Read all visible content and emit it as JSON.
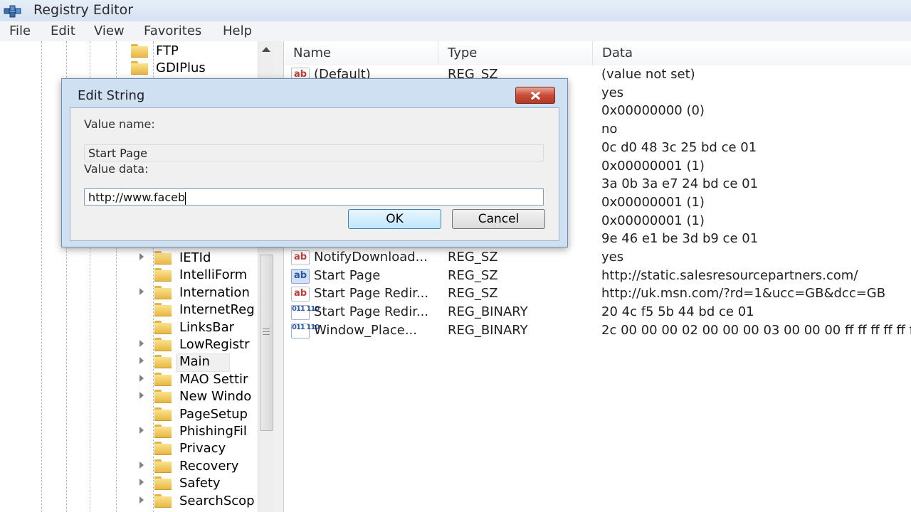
{
  "window": {
    "title": "Registry Editor"
  },
  "menu": [
    "File",
    "Edit",
    "View",
    "Favorites",
    "Help"
  ],
  "tree_top": [
    {
      "label": "FTP"
    },
    {
      "label": "GDIPlus"
    }
  ],
  "tree_items": [
    {
      "label": "IETId",
      "expandable": true
    },
    {
      "label": "IntelliForm",
      "expandable": false
    },
    {
      "label": "Internation",
      "expandable": true
    },
    {
      "label": "InternetReg",
      "expandable": false
    },
    {
      "label": "LinksBar",
      "expandable": false
    },
    {
      "label": "LowRegistr",
      "expandable": true
    },
    {
      "label": "Main",
      "expandable": true,
      "selected": true
    },
    {
      "label": "MAO Settir",
      "expandable": true
    },
    {
      "label": "New Windo",
      "expandable": true
    },
    {
      "label": "PageSetup",
      "expandable": false
    },
    {
      "label": "PhishingFil",
      "expandable": true
    },
    {
      "label": "Privacy",
      "expandable": false
    },
    {
      "label": "Recovery",
      "expandable": true
    },
    {
      "label": "Safety",
      "expandable": true
    },
    {
      "label": "SearchScop",
      "expandable": true
    }
  ],
  "columns": {
    "name": "Name",
    "type": "Type",
    "data": "Data"
  },
  "values": [
    {
      "name": "(Default)",
      "type": "REG_SZ",
      "data": "(value not set)",
      "icon": "string-icon"
    },
    {
      "name": "",
      "type": "",
      "data": "yes",
      "icon": ""
    },
    {
      "name": "",
      "type": "",
      "data": "0x00000000 (0)",
      "icon": ""
    },
    {
      "name": "",
      "type": "",
      "data": "no",
      "icon": ""
    },
    {
      "name": "",
      "type": "",
      "data": "0c d0 48 3c 25 bd ce 01",
      "icon": ""
    },
    {
      "name": "",
      "type": "",
      "data": "0x00000001 (1)",
      "icon": ""
    },
    {
      "name": "",
      "type": "",
      "data": "3a 0b 3a e7 24 bd ce 01",
      "icon": ""
    },
    {
      "name": "",
      "type": "",
      "data": "0x00000001 (1)",
      "icon": ""
    },
    {
      "name": "",
      "type": "",
      "data": "0x00000001 (1)",
      "icon": ""
    },
    {
      "name": "",
      "type": "",
      "data": "9e 46 e1 be 3d b9 ce 01",
      "icon": ""
    },
    {
      "name": "NotifyDownload...",
      "type": "REG_SZ",
      "data": "yes",
      "icon": "string-icon"
    },
    {
      "name": "Start Page",
      "type": "REG_SZ",
      "data": "http://static.salesresourcepartners.com/",
      "icon": "string-icon-selected"
    },
    {
      "name": "Start Page Redir...",
      "type": "REG_SZ",
      "data": "http://uk.msn.com/?rd=1&ucc=GB&dcc=GB",
      "icon": "string-icon"
    },
    {
      "name": "Start Page Redir...",
      "type": "REG_BINARY",
      "data": "20 4c f5 5b 44 bd ce 01",
      "icon": "binary-icon"
    },
    {
      "name": "Window_Place...",
      "type": "REG_BINARY",
      "data": "2c 00 00 00 02 00 00 00 03 00 00 00 ff ff ff ff ff ff",
      "icon": "binary-icon"
    }
  ],
  "dialog": {
    "title": "Edit String",
    "value_name_label": "Value name:",
    "value_name": "Start Page",
    "value_data_label": "Value data:",
    "value_data": "http://www.faceb",
    "ok_label": "OK",
    "cancel_label": "Cancel"
  },
  "icon_glyphs": {
    "string": "ab",
    "binary": "011 110"
  }
}
